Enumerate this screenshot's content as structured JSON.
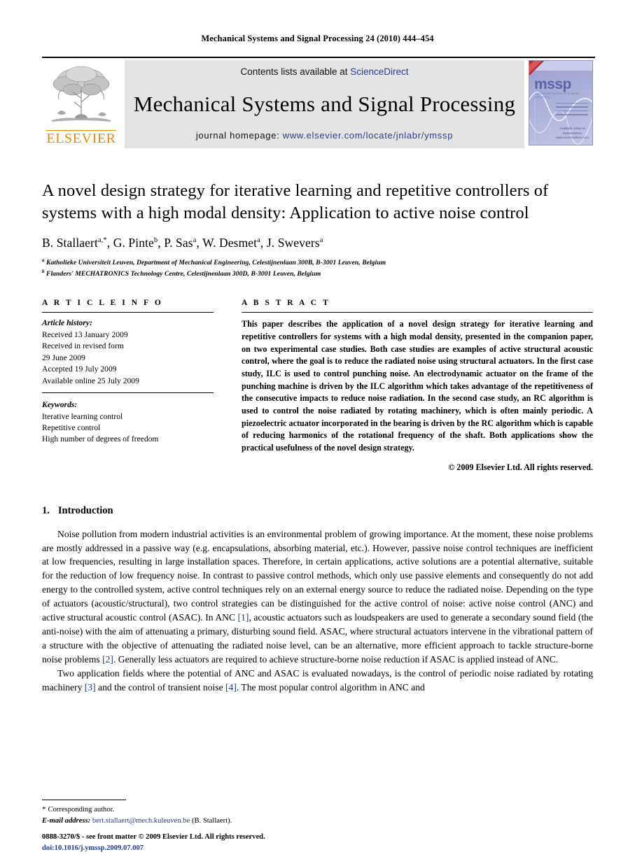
{
  "running_head": "Mechanical Systems and Signal Processing 24 (2010) 444–454",
  "banner": {
    "contents_prefix": "Contents lists available at ",
    "sciencedirect": "ScienceDirect",
    "journal_title": "Mechanical Systems and Signal Processing",
    "homepage_label": "journal homepage: ",
    "homepage_url": "www.elsevier.com/locate/jnlabr/ymssp",
    "publisher_wordmark": "ELSEVIER",
    "cover_wordmark": "mssp",
    "cover_subtitle": "mechanical systems and signal processing",
    "cover_footer": "Available online at\nScienceDirect\nwww.sciencedirect.com",
    "accent_orange": "#ed8b00",
    "link_blue": "#2b3a8f",
    "banner_grey": "#e4e4e4"
  },
  "title": "A novel design strategy for iterative learning and repetitive controllers of systems with a high modal density: Application to active noise control",
  "authors": [
    {
      "name": "B. Stallaert",
      "marks": "a,*"
    },
    {
      "name": "G. Pinte",
      "marks": "b"
    },
    {
      "name": "P. Sas",
      "marks": "a"
    },
    {
      "name": "W. Desmet",
      "marks": "a"
    },
    {
      "name": "J. Swevers",
      "marks": "a"
    }
  ],
  "affiliations": [
    {
      "mark": "a",
      "text": "Katholieke Universiteit Leuven, Department of Mechanical Engineering, Celestijnenlaan 300B, B-3001 Leuven, Belgium"
    },
    {
      "mark": "b",
      "text": "Flanders' MECHATRONICS Technology Centre, Celestijnenlaan 300D, B-3001 Leuven, Belgium"
    }
  ],
  "article_info": {
    "heading": "A R T I C L E   I N F O",
    "history_label": "Article history:",
    "history": [
      "Received 13 January 2009",
      "Received in revised form",
      "29 June 2009",
      "Accepted 19 July 2009",
      "Available online 25 July 2009"
    ],
    "keywords_label": "Keywords:",
    "keywords": [
      "Iterative learning control",
      "Repetitive control",
      "High number of degrees of freedom"
    ]
  },
  "abstract": {
    "heading": "A B S T R A C T",
    "text": "This paper describes the application of a novel design strategy for iterative learning and repetitive controllers for systems with a high modal density, presented in the companion paper, on two experimental case studies. Both case studies are examples of active structural acoustic control, where the goal is to reduce the radiated noise using structural actuators. In the first case study, ILC is used to control punching noise. An electrodynamic actuator on the frame of the punching machine is driven by the ILC algorithm which takes advantage of the repetitiveness of the consecutive impacts to reduce noise radiation. In the second case study, an RC algorithm is used to control the noise radiated by rotating machinery, which is often mainly periodic. A piezoelectric actuator incorporated in the bearing is driven by the RC algorithm which is capable of reducing harmonics of the rotational frequency of the shaft. Both applications show the practical usefulness of the novel design strategy.",
    "copyright": "© 2009 Elsevier Ltd. All rights reserved."
  },
  "introduction": {
    "number": "1.",
    "heading": "Introduction",
    "paragraph_1_a": "Noise pollution from modern industrial activities is an environmental problem of growing importance. At the moment, these noise problems are mostly addressed in a passive way (e.g. encapsulations, absorbing material, etc.). However, passive noise control techniques are inefficient at low frequencies, resulting in large installation spaces. Therefore, in certain applications, active solutions are a potential alternative, suitable for the reduction of low frequency noise. In contrast to passive control methods, which only use passive elements and consequently do not add energy to the controlled system, active control techniques rely on an external energy source to reduce the radiated noise. Depending on the type of actuators (acoustic/structural), two control strategies can be distinguished for the active control of noise: active noise control (ANC) and active structural acoustic control (ASAC). In ANC ",
    "ref_1": "[1]",
    "paragraph_1_b": ", acoustic actuators such as loudspeakers are used to generate a secondary sound field (the anti-noise) with the aim of attenuating a primary, disturbing sound field. ASAC, where structural actuators intervene in the vibrational pattern of a structure with the objective of attenuating the radiated noise level, can be an alternative, more efficient approach to tackle structure-borne noise problems ",
    "ref_2": "[2]",
    "paragraph_1_c": ". Generally less actuators are required to achieve structure-borne noise reduction if ASAC is applied instead of ANC.",
    "paragraph_2_a": "Two application fields where the potential of ANC and ASAC is evaluated nowadays, is the control of periodic noise radiated by rotating machinery ",
    "ref_3": "[3]",
    "paragraph_2_b": " and the control of transient noise ",
    "ref_4": "[4]",
    "paragraph_2_c": ". The most popular control algorithm in ANC and"
  },
  "footnotes": {
    "corresponding": "Corresponding author.",
    "email_label": "E-mail address: ",
    "email": "bert.stallaert@mech.kuleuven.be",
    "email_suffix": " (B. Stallaert)."
  },
  "imprint": {
    "issn_line": "0888-3270/$ - see front matter © 2009 Elsevier Ltd. All rights reserved.",
    "doi": "doi:10.1016/j.ymssp.2009.07.007"
  }
}
